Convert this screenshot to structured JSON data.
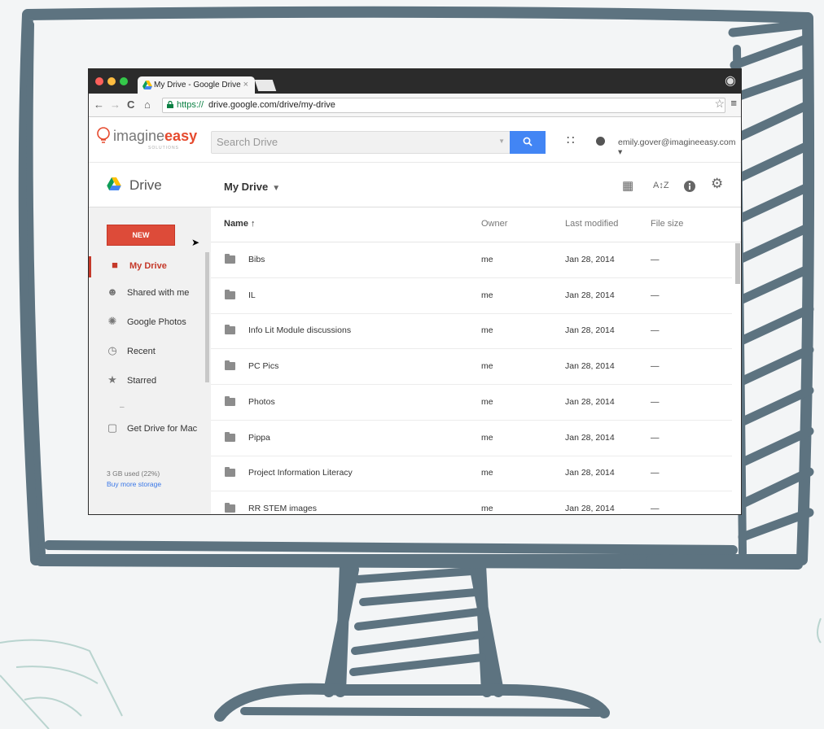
{
  "browser": {
    "tab_title": "My Drive - Google Drive",
    "tab_close": "×",
    "url_https": "https://",
    "url_rest": "drive.google.com/drive/my-drive",
    "nav_back": "←",
    "nav_forward": "→",
    "nav_reload": "C",
    "nav_home": "⌂",
    "bookmark": "☆",
    "menu": "≡"
  },
  "header": {
    "brand_part1": "imagine",
    "brand_part2": "easy",
    "brand_sub": "SOLUTIONS",
    "search_placeholder": "Search Drive",
    "account": "emily.gover@imagineeasy.com",
    "account_caret": "▾"
  },
  "drivebar": {
    "title": "Drive",
    "location": "My Drive",
    "location_caret": "▼"
  },
  "sidebar": {
    "new_label": "NEW",
    "items": [
      {
        "label": "My Drive",
        "icon": "drive-folder-icon"
      },
      {
        "label": "Shared with me",
        "icon": "people-icon"
      },
      {
        "label": "Google Photos",
        "icon": "pinwheel-icon"
      },
      {
        "label": "Recent",
        "icon": "clock-icon"
      },
      {
        "label": "Starred",
        "icon": "star-icon"
      },
      {
        "label": "Get Drive for Mac",
        "icon": "monitor-icon"
      }
    ],
    "divider": "–",
    "storage": "3 GB used (22%)",
    "buy_storage": "Buy more storage"
  },
  "list": {
    "columns": [
      "Name ↑",
      "Owner",
      "Last modified",
      "File size"
    ],
    "rows": [
      {
        "name": "Bibs",
        "owner": "me",
        "modified": "Jan 28, 2014",
        "size": "—"
      },
      {
        "name": "IL",
        "owner": "me",
        "modified": "Jan 28, 2014",
        "size": "—"
      },
      {
        "name": "Info Lit Module discussions",
        "owner": "me",
        "modified": "Jan 28, 2014",
        "size": "—"
      },
      {
        "name": "PC Pics",
        "owner": "me",
        "modified": "Jan 28, 2014",
        "size": "—"
      },
      {
        "name": "Photos",
        "owner": "me",
        "modified": "Jan 28, 2014",
        "size": "—"
      },
      {
        "name": "Pippa",
        "owner": "me",
        "modified": "Jan 28, 2014",
        "size": "—"
      },
      {
        "name": "Project Information Literacy",
        "owner": "me",
        "modified": "Jan 28, 2014",
        "size": "—"
      },
      {
        "name": "RR STEM images",
        "owner": "me",
        "modified": "Jan 28, 2014",
        "size": "—"
      }
    ]
  },
  "colors": {
    "accent_red": "#dd4b39",
    "search_blue": "#4285f4",
    "sketch_frame": "#5d7380"
  }
}
